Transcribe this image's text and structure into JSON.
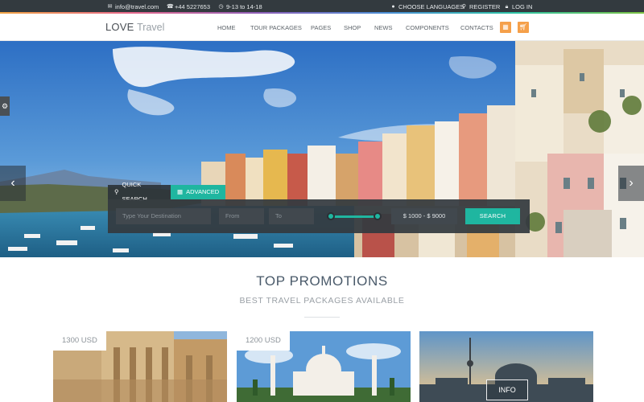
{
  "topbar": {
    "email": "info@travel.com",
    "phone": "+44 5227653",
    "hours": "9-13 to 14-18",
    "languages": "CHOOSE LANGUAGES",
    "register": "REGISTER",
    "login": "LOG IN"
  },
  "nav": {
    "logo_bold": "LOVE",
    "logo_light": "Travel",
    "menu": [
      "HOME",
      "TOUR PACKAGES",
      "PAGES",
      "SHOP",
      "NEWS",
      "COMPONENTS",
      "CONTACTS"
    ]
  },
  "search": {
    "tab_quick": "QUICK SEARCH",
    "tab_advanced": "ADVANCED",
    "destination_placeholder": "Type Your Destination",
    "from_placeholder": "From",
    "to_placeholder": "To",
    "price_range": "$ 1000 - $ 9000",
    "search_label": "SEARCH"
  },
  "promotions": {
    "title": "TOP PROMOTIONS",
    "subtitle": "BEST TRAVEL PACKAGES AVAILABLE",
    "cards": [
      {
        "price": "1300 USD"
      },
      {
        "price": "1200 USD"
      },
      {
        "info": "INFO"
      }
    ]
  },
  "icons": {
    "email": "envelope-icon",
    "phone": "phone-icon",
    "hours": "clock-icon",
    "languages": "globe-icon",
    "register": "user-plus-icon",
    "login": "lock-icon",
    "navbtn1": "grid-icon",
    "navbtn2": "cart-icon",
    "settings": "gear-icon"
  },
  "colors": {
    "accent": "#1fb6a0",
    "orange": "#f5a04a",
    "topbar": "#333a3f"
  }
}
